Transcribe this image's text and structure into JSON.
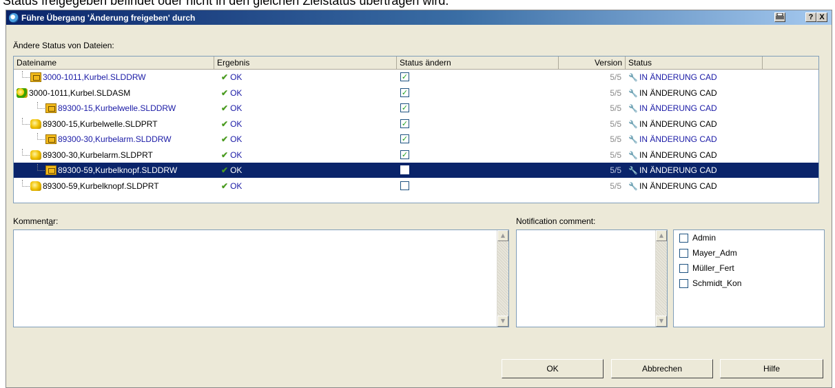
{
  "background_text": "Status freigegeben befindet oder nicht in den gleichen Zielstatus übertragen wird.",
  "dialog": {
    "title": "Führe Übergang 'Änderung freigeben' durch",
    "print_icon": "printer-icon",
    "help_label": "?",
    "close_label": "X"
  },
  "files_section": {
    "label": "Ändere Status von Dateien:",
    "columns": [
      "Dateiname",
      "Ergebnis",
      "Status ändern",
      "Version",
      "Status"
    ],
    "rows": [
      {
        "name": "3000-1011,Kurbel.SLDDRW",
        "icon": "drawing-icon",
        "indent": 1,
        "blue": true,
        "result": "OK",
        "checked": true,
        "version": "5/5",
        "status": "IN ÄNDERUNG CAD",
        "status_blue": true,
        "selected": false
      },
      {
        "name": "3000-1011,Kurbel.SLDASM",
        "icon": "assembly-icon",
        "indent": 0,
        "blue": false,
        "result": "OK",
        "checked": true,
        "version": "5/5",
        "status": "IN ÄNDERUNG CAD",
        "status_blue": false,
        "selected": false
      },
      {
        "name": "89300-15,Kurbelwelle.SLDDRW",
        "icon": "drawing-icon",
        "indent": 2,
        "blue": true,
        "result": "OK",
        "checked": true,
        "version": "5/5",
        "status": "IN ÄNDERUNG CAD",
        "status_blue": true,
        "selected": false
      },
      {
        "name": "89300-15,Kurbelwelle.SLDPRT",
        "icon": "part-icon",
        "indent": 1,
        "blue": false,
        "result": "OK",
        "checked": true,
        "version": "5/5",
        "status": "IN ÄNDERUNG CAD",
        "status_blue": false,
        "selected": false
      },
      {
        "name": "89300-30,Kurbelarm.SLDDRW",
        "icon": "drawing-icon",
        "indent": 2,
        "blue": true,
        "result": "OK",
        "checked": true,
        "version": "5/5",
        "status": "IN ÄNDERUNG CAD",
        "status_blue": true,
        "selected": false
      },
      {
        "name": "89300-30,Kurbelarm.SLDPRT",
        "icon": "part-icon",
        "indent": 1,
        "blue": false,
        "result": "OK",
        "checked": true,
        "version": "5/5",
        "status": "IN ÄNDERUNG CAD",
        "status_blue": false,
        "selected": false
      },
      {
        "name": "89300-59,Kurbelknopf.SLDDRW",
        "icon": "drawing-icon",
        "indent": 2,
        "blue": false,
        "result": "OK",
        "checked": false,
        "version": "5/5",
        "status": "IN ÄNDERUNG CAD",
        "status_blue": false,
        "selected": true
      },
      {
        "name": "89300-59,Kurbelknopf.SLDPRT",
        "icon": "part-icon",
        "indent": 1,
        "blue": false,
        "result": "OK",
        "checked": false,
        "version": "5/5",
        "status": "IN ÄNDERUNG CAD",
        "status_blue": false,
        "selected": false
      }
    ]
  },
  "comment": {
    "label": "Kommentar:",
    "value": ""
  },
  "notification": {
    "label": "Notification comment:",
    "value": "",
    "users": [
      {
        "name": "Admin",
        "checked": false
      },
      {
        "name": "Mayer_Adm",
        "checked": false
      },
      {
        "name": "Müller_Fert",
        "checked": false
      },
      {
        "name": "Schmidt_Kon",
        "checked": false
      }
    ]
  },
  "buttons": {
    "ok": "OK",
    "cancel": "Abbrechen",
    "help": "Hilfe"
  }
}
